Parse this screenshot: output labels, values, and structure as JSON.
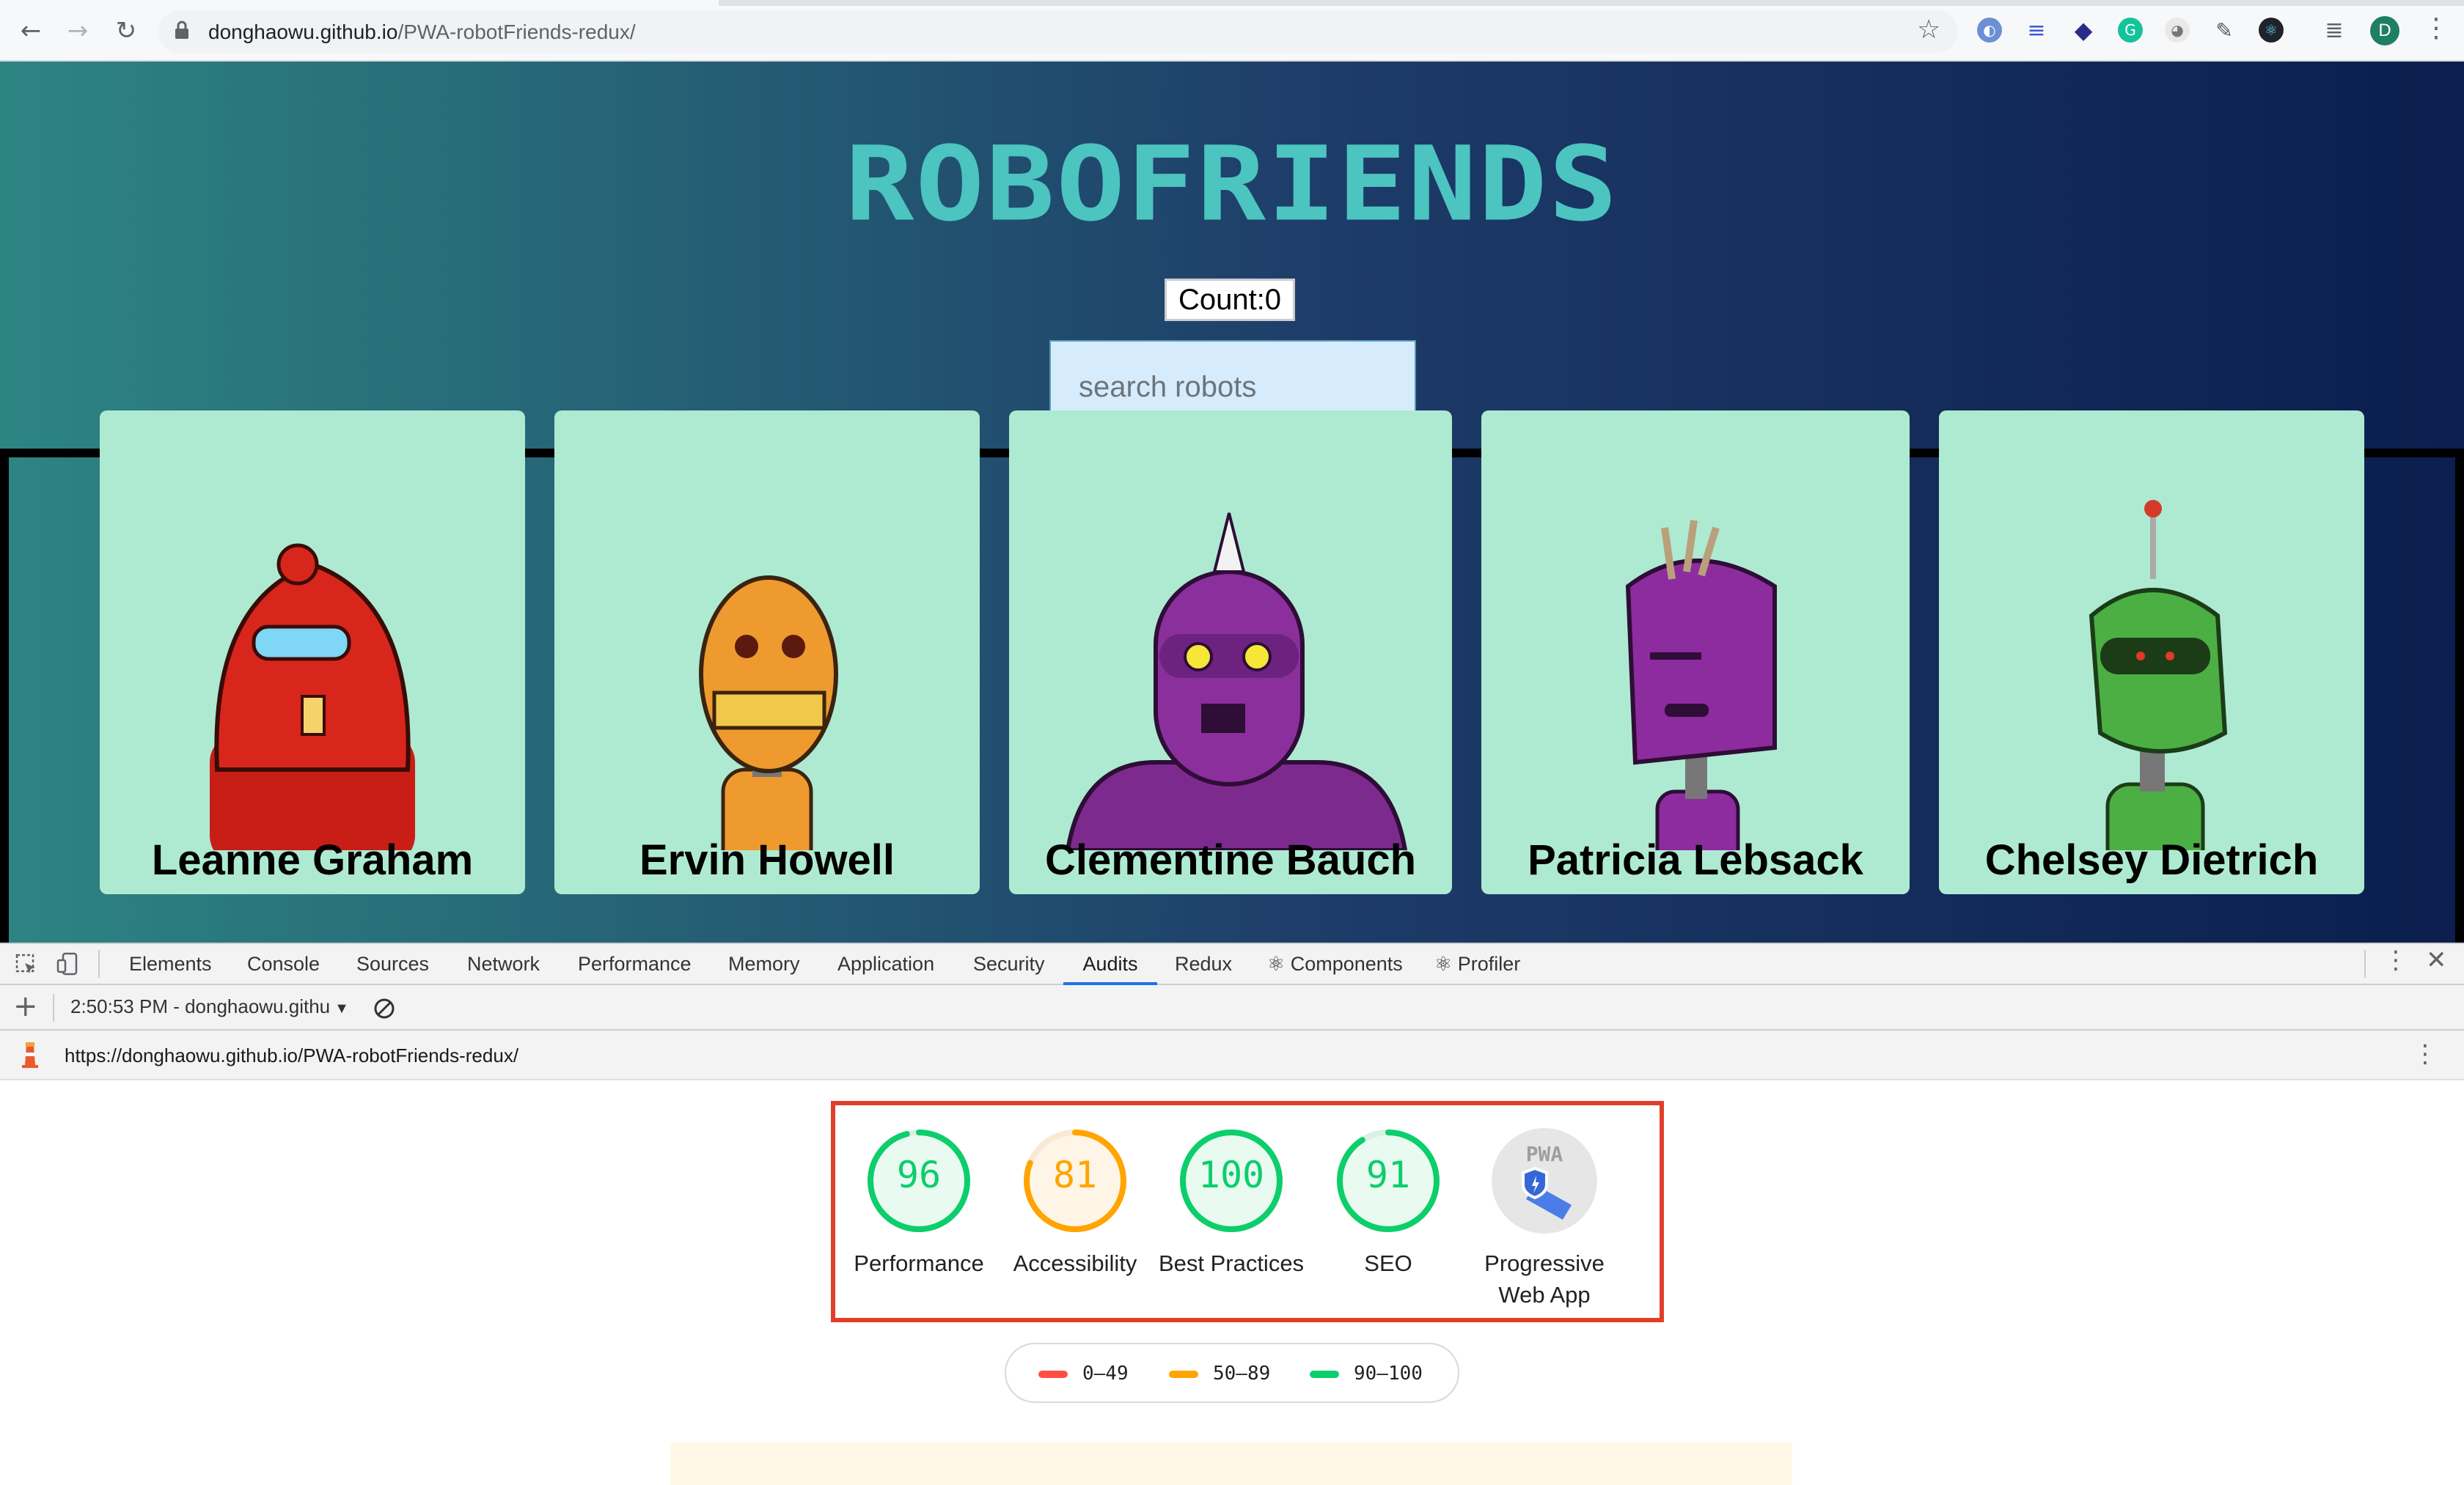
{
  "browser": {
    "url_host": "donghaowu.github.io",
    "url_path": "/PWA-robotFriends-redux/",
    "avatar_letter": "D",
    "extensions": [
      "pocket-icon",
      "stacked-lines-icon",
      "diamond-icon",
      "grammarly-icon",
      "cat-icon",
      "eyedropper-icon",
      "react-icon"
    ]
  },
  "page": {
    "logo": "ROBOFRIENDS",
    "count_label": "Count:0",
    "search_placeholder": "search robots",
    "robots": [
      {
        "name": "Leanne Graham",
        "color": "#d9261c"
      },
      {
        "name": "Ervin Howell",
        "color": "#ee9a2e"
      },
      {
        "name": "Clementine Bauch",
        "color": "#8a2f9c"
      },
      {
        "name": "Patricia Lebsack",
        "color": "#8d2c9e"
      },
      {
        "name": "Chelsey Dietrich",
        "color": "#4caf43"
      }
    ]
  },
  "devtools": {
    "tabs": [
      "Elements",
      "Console",
      "Sources",
      "Network",
      "Performance",
      "Memory",
      "Application",
      "Security",
      "Audits",
      "Redux",
      "⚛ Components",
      "⚛ Profiler"
    ],
    "active_tab": "Audits",
    "report_selector": "2:50:53 PM - donghaowu.githu",
    "report_url": "https://donghaowu.github.io/PWA-robotFriends-redux/"
  },
  "audit": {
    "scores": [
      {
        "label": "Performance",
        "value": "96",
        "fraction": 0.96,
        "color": "#0cce6b"
      },
      {
        "label": "Accessibility",
        "value": "81",
        "fraction": 0.81,
        "color": "#ffa400"
      },
      {
        "label": "Best Practices",
        "value": "100",
        "fraction": 1.0,
        "color": "#0cce6b"
      },
      {
        "label": "SEO",
        "value": "91",
        "fraction": 0.91,
        "color": "#0cce6b"
      },
      {
        "label": "Progressive Web App",
        "badge": "PWA"
      }
    ],
    "legend": [
      {
        "range": "0–49",
        "color": "#ff4e42"
      },
      {
        "range": "50–89",
        "color": "#ffa400"
      },
      {
        "range": "90–100",
        "color": "#0cce6b"
      }
    ]
  }
}
